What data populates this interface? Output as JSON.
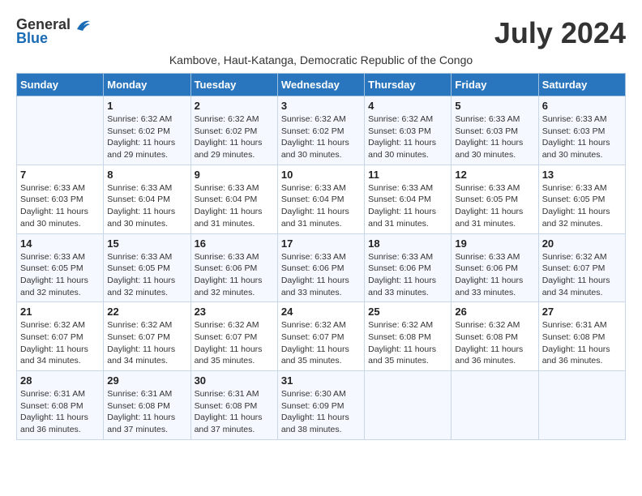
{
  "header": {
    "logo_general": "General",
    "logo_blue": "Blue",
    "month_title": "July 2024",
    "subtitle": "Kambove, Haut-Katanga, Democratic Republic of the Congo"
  },
  "weekdays": [
    "Sunday",
    "Monday",
    "Tuesday",
    "Wednesday",
    "Thursday",
    "Friday",
    "Saturday"
  ],
  "weeks": [
    [
      {
        "day": "",
        "info": ""
      },
      {
        "day": "1",
        "info": "Sunrise: 6:32 AM\nSunset: 6:02 PM\nDaylight: 11 hours\nand 29 minutes."
      },
      {
        "day": "2",
        "info": "Sunrise: 6:32 AM\nSunset: 6:02 PM\nDaylight: 11 hours\nand 29 minutes."
      },
      {
        "day": "3",
        "info": "Sunrise: 6:32 AM\nSunset: 6:02 PM\nDaylight: 11 hours\nand 30 minutes."
      },
      {
        "day": "4",
        "info": "Sunrise: 6:32 AM\nSunset: 6:03 PM\nDaylight: 11 hours\nand 30 minutes."
      },
      {
        "day": "5",
        "info": "Sunrise: 6:33 AM\nSunset: 6:03 PM\nDaylight: 11 hours\nand 30 minutes."
      },
      {
        "day": "6",
        "info": "Sunrise: 6:33 AM\nSunset: 6:03 PM\nDaylight: 11 hours\nand 30 minutes."
      }
    ],
    [
      {
        "day": "7",
        "info": "Sunrise: 6:33 AM\nSunset: 6:03 PM\nDaylight: 11 hours\nand 30 minutes."
      },
      {
        "day": "8",
        "info": "Sunrise: 6:33 AM\nSunset: 6:04 PM\nDaylight: 11 hours\nand 30 minutes."
      },
      {
        "day": "9",
        "info": "Sunrise: 6:33 AM\nSunset: 6:04 PM\nDaylight: 11 hours\nand 31 minutes."
      },
      {
        "day": "10",
        "info": "Sunrise: 6:33 AM\nSunset: 6:04 PM\nDaylight: 11 hours\nand 31 minutes."
      },
      {
        "day": "11",
        "info": "Sunrise: 6:33 AM\nSunset: 6:04 PM\nDaylight: 11 hours\nand 31 minutes."
      },
      {
        "day": "12",
        "info": "Sunrise: 6:33 AM\nSunset: 6:05 PM\nDaylight: 11 hours\nand 31 minutes."
      },
      {
        "day": "13",
        "info": "Sunrise: 6:33 AM\nSunset: 6:05 PM\nDaylight: 11 hours\nand 32 minutes."
      }
    ],
    [
      {
        "day": "14",
        "info": "Sunrise: 6:33 AM\nSunset: 6:05 PM\nDaylight: 11 hours\nand 32 minutes."
      },
      {
        "day": "15",
        "info": "Sunrise: 6:33 AM\nSunset: 6:05 PM\nDaylight: 11 hours\nand 32 minutes."
      },
      {
        "day": "16",
        "info": "Sunrise: 6:33 AM\nSunset: 6:06 PM\nDaylight: 11 hours\nand 32 minutes."
      },
      {
        "day": "17",
        "info": "Sunrise: 6:33 AM\nSunset: 6:06 PM\nDaylight: 11 hours\nand 33 minutes."
      },
      {
        "day": "18",
        "info": "Sunrise: 6:33 AM\nSunset: 6:06 PM\nDaylight: 11 hours\nand 33 minutes."
      },
      {
        "day": "19",
        "info": "Sunrise: 6:33 AM\nSunset: 6:06 PM\nDaylight: 11 hours\nand 33 minutes."
      },
      {
        "day": "20",
        "info": "Sunrise: 6:32 AM\nSunset: 6:07 PM\nDaylight: 11 hours\nand 34 minutes."
      }
    ],
    [
      {
        "day": "21",
        "info": "Sunrise: 6:32 AM\nSunset: 6:07 PM\nDaylight: 11 hours\nand 34 minutes."
      },
      {
        "day": "22",
        "info": "Sunrise: 6:32 AM\nSunset: 6:07 PM\nDaylight: 11 hours\nand 34 minutes."
      },
      {
        "day": "23",
        "info": "Sunrise: 6:32 AM\nSunset: 6:07 PM\nDaylight: 11 hours\nand 35 minutes."
      },
      {
        "day": "24",
        "info": "Sunrise: 6:32 AM\nSunset: 6:07 PM\nDaylight: 11 hours\nand 35 minutes."
      },
      {
        "day": "25",
        "info": "Sunrise: 6:32 AM\nSunset: 6:08 PM\nDaylight: 11 hours\nand 35 minutes."
      },
      {
        "day": "26",
        "info": "Sunrise: 6:32 AM\nSunset: 6:08 PM\nDaylight: 11 hours\nand 36 minutes."
      },
      {
        "day": "27",
        "info": "Sunrise: 6:31 AM\nSunset: 6:08 PM\nDaylight: 11 hours\nand 36 minutes."
      }
    ],
    [
      {
        "day": "28",
        "info": "Sunrise: 6:31 AM\nSunset: 6:08 PM\nDaylight: 11 hours\nand 36 minutes."
      },
      {
        "day": "29",
        "info": "Sunrise: 6:31 AM\nSunset: 6:08 PM\nDaylight: 11 hours\nand 37 minutes."
      },
      {
        "day": "30",
        "info": "Sunrise: 6:31 AM\nSunset: 6:08 PM\nDaylight: 11 hours\nand 37 minutes."
      },
      {
        "day": "31",
        "info": "Sunrise: 6:30 AM\nSunset: 6:09 PM\nDaylight: 11 hours\nand 38 minutes."
      },
      {
        "day": "",
        "info": ""
      },
      {
        "day": "",
        "info": ""
      },
      {
        "day": "",
        "info": ""
      }
    ]
  ]
}
